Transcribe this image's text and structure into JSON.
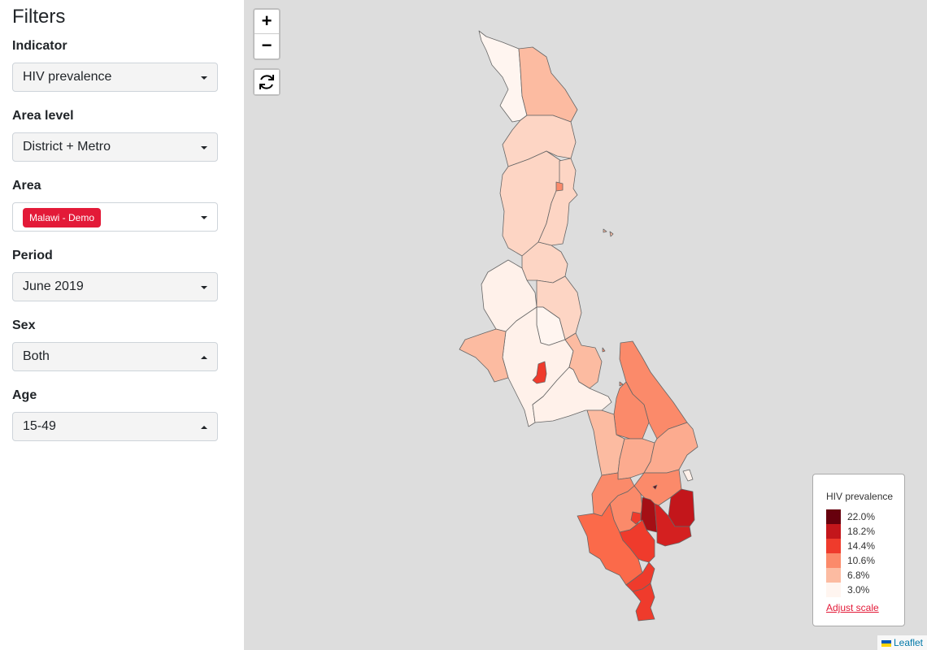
{
  "sidebar": {
    "title": "Filters",
    "filters": [
      {
        "label": "Indicator",
        "value": "HIV prevalence"
      },
      {
        "label": "Area level",
        "value": "District + Metro"
      },
      {
        "label": "Area",
        "value": "Malawi - Demo"
      },
      {
        "label": "Period",
        "value": "June 2019"
      },
      {
        "label": "Sex",
        "value": "Both"
      },
      {
        "label": "Age",
        "value": "15-49"
      }
    ]
  },
  "map": {
    "zoom_in": "+",
    "zoom_out": "−",
    "reset_icon": "refresh-icon",
    "legend": {
      "title": "HIV prevalence",
      "items": [
        {
          "label": "22.0%",
          "color": "#67000d"
        },
        {
          "label": "18.2%",
          "color": "#c3161b"
        },
        {
          "label": "14.4%",
          "color": "#ef3b2c"
        },
        {
          "label": "10.6%",
          "color": "#fb8a6a"
        },
        {
          "label": "6.8%",
          "color": "#fcbba1"
        },
        {
          "label": "3.0%",
          "color": "#fff5f0"
        }
      ],
      "adjust_label": "Adjust scale"
    },
    "attribution": "Leaflet"
  }
}
